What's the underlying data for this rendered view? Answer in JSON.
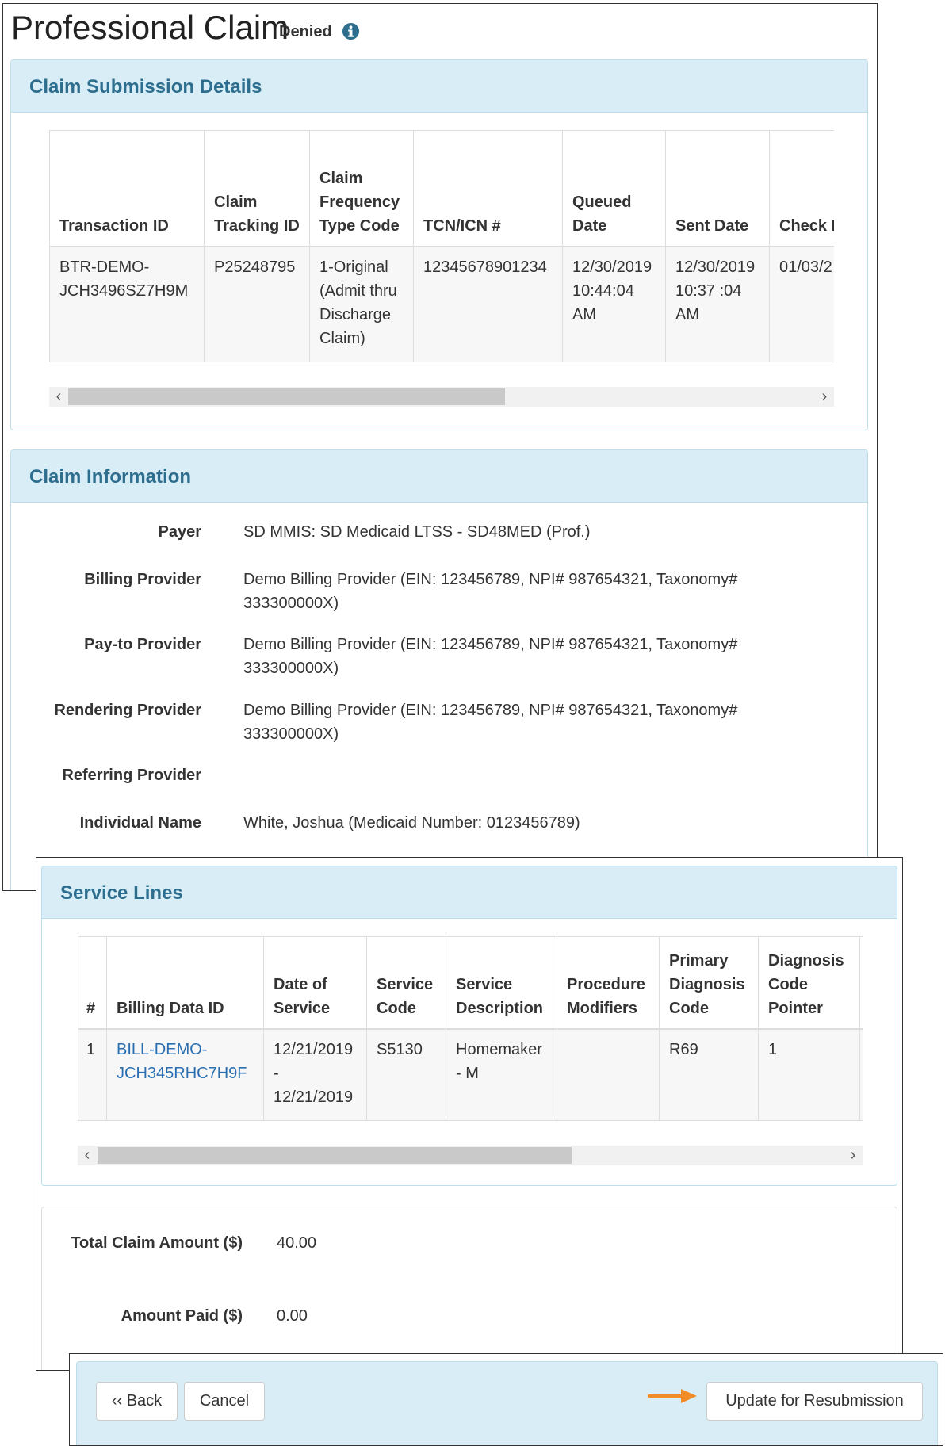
{
  "page": {
    "title": "Professional Claim",
    "status": "Denied"
  },
  "submission": {
    "heading": "Claim Submission Details",
    "columns": [
      "Transaction ID",
      "Claim Tracking ID",
      "Claim Frequency Type Code",
      "TCN/ICN #",
      "Queued Date",
      "Sent Date",
      "Check Issue Date"
    ],
    "row": [
      "BTR-DEMO-JCH3496SZ7H9M",
      "P25248795",
      "1-Original (Admit thru Discharge Claim)",
      "12345678901234",
      "12/30/2019 10:44:04 AM",
      "12/30/2019 10:37 :04 AM",
      "01/03/2"
    ]
  },
  "claim_info": {
    "heading": "Claim Information",
    "fields": [
      {
        "label": "Payer",
        "value": "SD MMIS: SD Medicaid LTSS - SD48MED (Prof.)"
      },
      {
        "label": "Billing Provider",
        "value": "Demo Billing Provider (EIN: 123456789, NPI# 987654321, Taxonomy# 333300000X)"
      },
      {
        "label": "Pay-to Provider",
        "value": "Demo Billing Provider (EIN: 123456789, NPI# 987654321, Taxonomy# 333300000X)"
      },
      {
        "label": "Rendering Provider",
        "value": "Demo Billing Provider (EIN: 123456789, NPI# 987654321, Taxonomy# 333300000X)"
      },
      {
        "label": "Referring Provider",
        "value": ""
      },
      {
        "label": "Individual Name",
        "value": "White, Joshua (Medicaid Number: 0123456789)"
      }
    ]
  },
  "service_lines": {
    "heading": "Service Lines",
    "columns": [
      "#",
      "Billing Data ID",
      "Date of Service",
      "Service Code",
      "Service Description",
      "Procedure Modifiers",
      "Primary Diagnosis Code",
      "Diagnosis Code Pointer"
    ],
    "row": [
      "1",
      "BILL-DEMO-JCH345RHC7H9F",
      "12/21/2019 - 12/21/2019",
      "S5130",
      "Homemaker - M",
      "",
      "R69",
      "1"
    ]
  },
  "totals": {
    "total_label": "Total Claim Amount ($)",
    "total_value": "40.00",
    "paid_label": "Amount Paid ($)",
    "paid_value": "0.00"
  },
  "actions": {
    "back": "‹‹ Back",
    "cancel": "Cancel",
    "resubmit": "Update for Resubmission"
  },
  "icons": {
    "status_info": "info-icon",
    "callout": "arrow-right-icon",
    "scroll_left": "chevron-left-icon",
    "scroll_right": "chevron-right-icon"
  },
  "colors": {
    "accent": "#2d6e8e",
    "panel_heading": "#d9edf7",
    "link": "#2a6eb0",
    "arrow": "#f28c28"
  }
}
